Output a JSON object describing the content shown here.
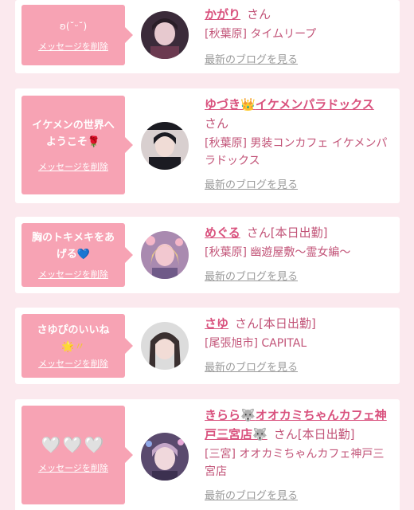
{
  "cards": [
    {
      "message": "ʚ(˘ᵕ˘)",
      "delete_label": "メッセージを削除",
      "name": "かがり",
      "honorific": "さん",
      "status": "",
      "shop": "[秋葉原] タイムリープ",
      "blog_label": "最新のブログを見る",
      "avatar_colors": [
        "#3b2b3a",
        "#e7c9cf"
      ]
    },
    {
      "message": "イケメンの世界へようこそ",
      "message_emoji": "🌹",
      "delete_label": "メッセージを削除",
      "name": "ゆづき",
      "name_emoji": "👑",
      "name_suffix": "イケメンパラドックス",
      "honorific": "さん",
      "status": "",
      "shop": "[秋葉原] 男装コンカフェ イケメンパラドックス",
      "blog_label": "最新のブログを見る",
      "avatar_colors": [
        "#1b1b22",
        "#d8cfcf"
      ]
    },
    {
      "message": "胸のトキメキをあげる",
      "message_emoji": "💙",
      "delete_label": "メッセージを削除",
      "name": "めぐる",
      "honorific": "さん",
      "status": "[本日出勤]",
      "shop": "[秋葉原] 幽遊屋敷〜霊女編〜",
      "blog_label": "最新のブログを見る",
      "avatar_colors": [
        "#a98ab0",
        "#f2c8d0"
      ]
    },
    {
      "message": "さゆぴのいいね",
      "message_emoji": "🌟〃",
      "delete_label": "メッセージを削除",
      "name": "さゆ",
      "honorific": "さん",
      "status": "[本日出勤]",
      "shop": "[尾張旭市] CAPITAL",
      "blog_label": "最新のブログを見る",
      "avatar_colors": [
        "#dcdcdc",
        "#3a3030"
      ]
    },
    {
      "message": "🤍🤍🤍",
      "delete_label": "メッセージを削除",
      "name": "きらら",
      "name_emoji": "🐺",
      "name_suffix": "オオカミちゃんカフェ神戸三宮店",
      "name_emoji2": "🐺",
      "honorific": "さん",
      "status": "[本日出勤]",
      "shop": "[三宮] オオカミちゃんカフェ神戸三宮店",
      "blog_label": "最新のブログを見る",
      "avatar_colors": [
        "#5a4a6e",
        "#f0d8dc"
      ]
    }
  ],
  "colors": {
    "background": "#fbe9ee",
    "bubble": "#f7a3b4",
    "name": "#d9527e",
    "text": "#c25478",
    "link_gray": "#9b9b9b"
  }
}
